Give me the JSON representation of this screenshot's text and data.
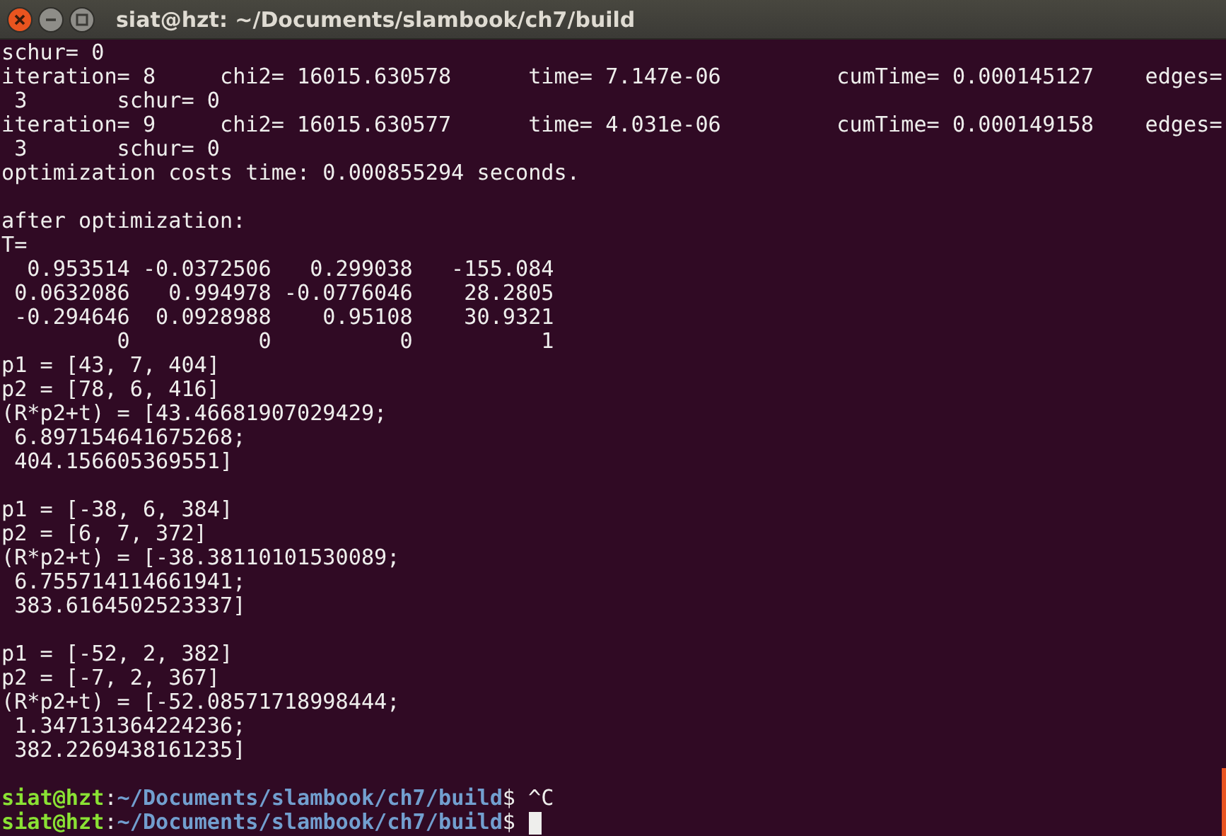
{
  "window": {
    "title": "siat@hzt: ~/Documents/slambook/ch7/build"
  },
  "terminal": {
    "blocks": [
      [
        "schur= 0",
        "iteration= 8     chi2= 16015.630578      time= 7.147e-06         cumTime= 0.000145127    edges=",
        " 3       schur= 0",
        "iteration= 9     chi2= 16015.630577      time= 4.031e-06         cumTime= 0.000149158    edges=",
        " 3       schur= 0",
        "optimization costs time: 0.000855294 seconds."
      ],
      [
        "after optimization:",
        "T=",
        "  0.953514 -0.0372506   0.299038   -155.084",
        " 0.0632086   0.994978 -0.0776046    28.2805",
        " -0.294646  0.0928988    0.95108    30.9321",
        "         0          0          0          1",
        "p1 = [43, 7, 404]",
        "p2 = [78, 6, 416]",
        "(R*p2+t) = [43.46681907029429;",
        " 6.897154641675268;",
        " 404.156605369551]"
      ],
      [
        "p1 = [-38, 6, 384]",
        "p2 = [6, 7, 372]",
        "(R*p2+t) = [-38.38110101530089;",
        " 6.755714114661941;",
        " 383.6164502523337]"
      ],
      [
        "p1 = [-52, 2, 382]",
        "p2 = [-7, 2, 367]",
        "(R*p2+t) = [-52.08571718998444;",
        " 1.347131364224236;",
        " 382.2269438161235]"
      ]
    ],
    "prompts": [
      {
        "user_host": "siat@hzt",
        "separator": ":",
        "path": "~/Documents/slambook/ch7/build",
        "symbol": "$",
        "input": "^C"
      },
      {
        "user_host": "siat@hzt",
        "separator": ":",
        "path": "~/Documents/slambook/ch7/build",
        "symbol": "$",
        "cursor": true
      }
    ]
  }
}
